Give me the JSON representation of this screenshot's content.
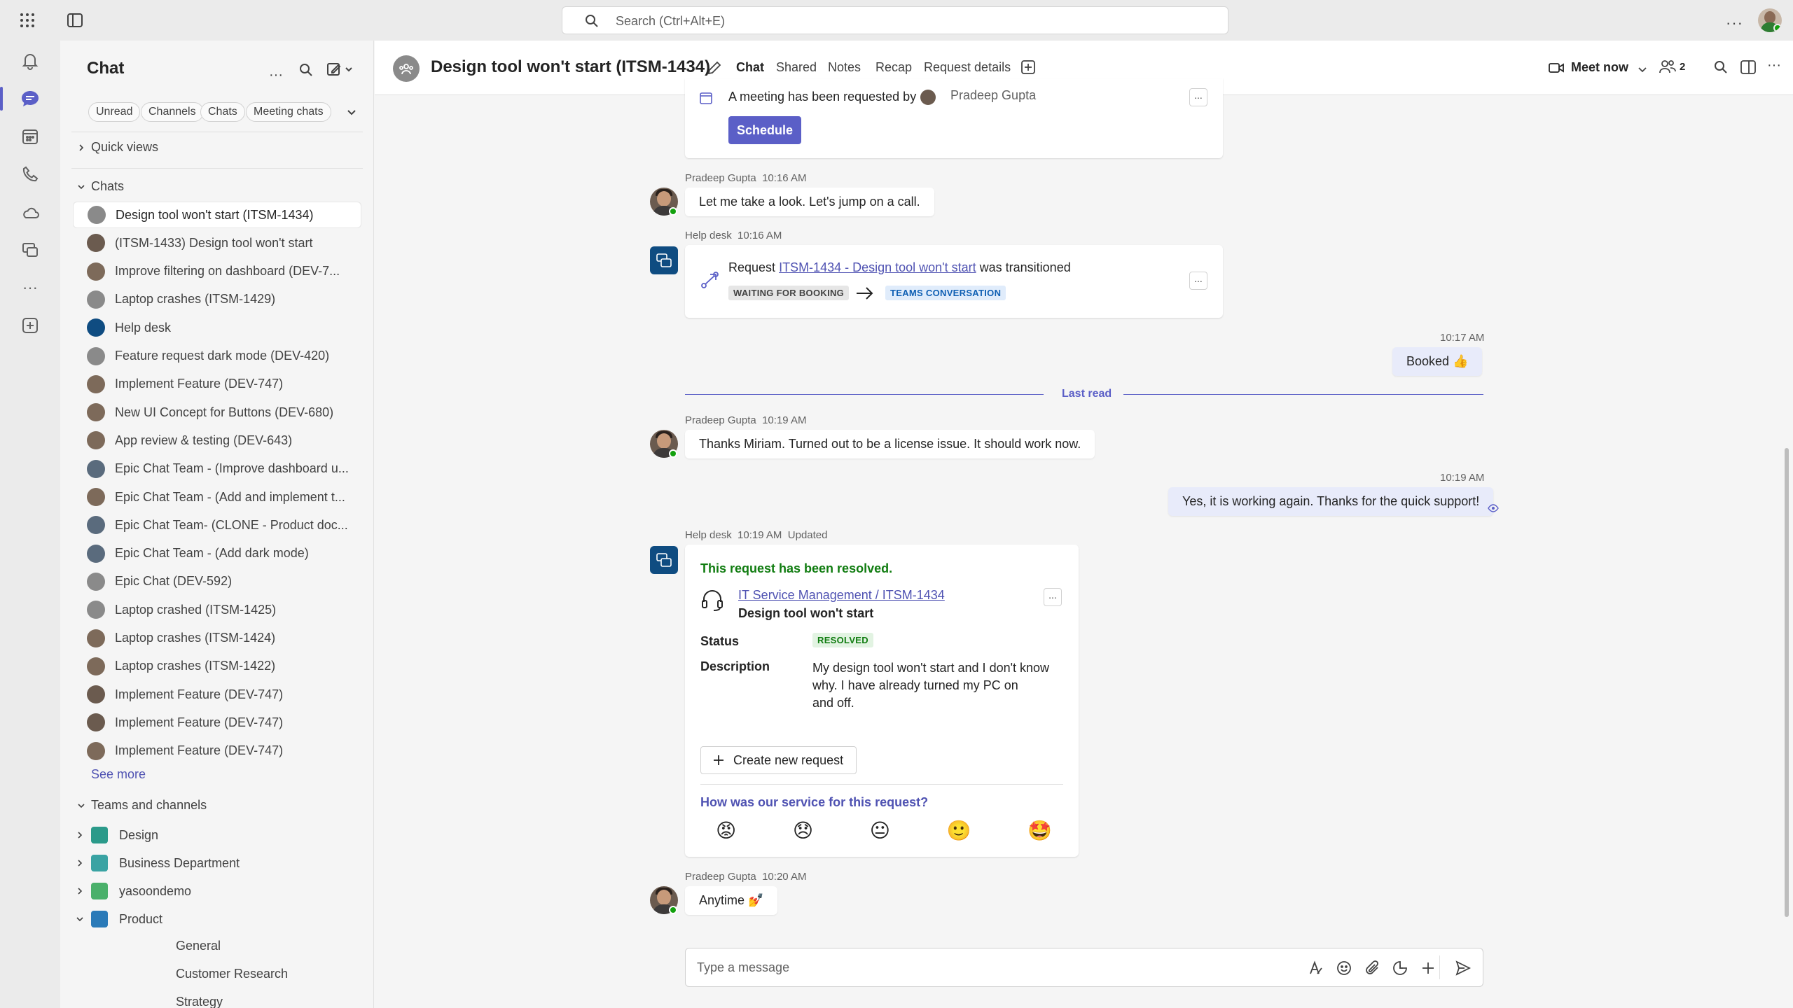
{
  "search": {
    "placeholder": "Search (Ctrl+Alt+E)"
  },
  "sidebar": {
    "title": "Chat",
    "filters": [
      "Unread",
      "Channels",
      "Chats",
      "Meeting chats"
    ],
    "quick_views": "Quick views",
    "chats_heading": "Chats",
    "chats": [
      "Design tool won't start (ITSM-1434)",
      "(ITSM-1433) Design tool won't start",
      "Improve filtering on dashboard (DEV-7...",
      "Laptop crashes (ITSM-1429)",
      "Help desk",
      "Feature request dark mode (DEV-420)",
      "Implement Feature (DEV-747)",
      "New UI Concept for Buttons (DEV-680)",
      "App review & testing (DEV-643)",
      "Epic Chat Team - (Improve dashboard u...",
      "Epic Chat Team - (Add and implement t...",
      "Epic Chat Team- (CLONE - Product doc...",
      "Epic Chat Team - (Add dark mode)",
      "Epic Chat (DEV-592)",
      "Laptop crashed (ITSM-1425)",
      "Laptop crashes (ITSM-1424)",
      "Laptop crashes (ITSM-1422)",
      "Implement Feature (DEV-747)",
      "Implement Feature (DEV-747)",
      "Implement Feature (DEV-747)"
    ],
    "see_more": "See more",
    "teams_heading": "Teams and channels",
    "teams": [
      "Design",
      "Business Department",
      "yasoondemo",
      "Product"
    ],
    "channels": [
      "General",
      "Customer Research",
      "Strategy"
    ]
  },
  "header": {
    "title": "Design tool won't start (ITSM-1434)",
    "tabs": [
      "Chat",
      "Shared",
      "Notes",
      "Recap",
      "Request details"
    ],
    "meet_now": "Meet now",
    "participants": "2"
  },
  "messages": {
    "meeting_request": "A meeting has been requested by",
    "meeting_requester": "Pradeep Gupta",
    "schedule_btn": "Schedule",
    "m1_sender": "Pradeep Gupta",
    "m1_time": "10:16 AM",
    "m1_text": "Let me take a look. Let's jump on a call.",
    "m2_sender": "Help desk",
    "m2_time": "10:16 AM",
    "m2_prefix": "Request",
    "m2_link": "ITSM-1434 - Design tool won't start",
    "m2_suffix": "was transitioned",
    "m2_from": "WAITING FOR BOOKING",
    "m2_to": "TEAMS CONVERSATION",
    "m3_time": "10:17 AM",
    "m3_text": "Booked 👍",
    "last_read": "Last read",
    "m4_sender": "Pradeep Gupta",
    "m4_time": "10:19 AM",
    "m4_text": "Thanks Miriam. Turned out to be a license issue. It should work now.",
    "m5_time": "10:19 AM",
    "m5_text": "Yes, it is working again. Thanks for the quick support!",
    "m6_sender": "Help desk",
    "m6_time": "10:19 AM",
    "m6_updated": "Updated",
    "m6_resolved": "This request has been resolved.",
    "m6_link": "IT Service Management / ITSM-1434",
    "m6_subtitle": "Design tool won't start",
    "m6_status_label": "Status",
    "m6_status_value": "RESOLVED",
    "m6_desc_label": "Description",
    "m6_desc_l1": "My design tool won't start and I don't know",
    "m6_desc_l2": "why. I have already turned my PC on",
    "m6_desc_l3": "and off.",
    "m6_create_btn": "Create new request",
    "m6_rating_q": "How was our service for this request?",
    "m6_ratings": [
      "😡",
      "😞",
      "😐",
      "🙂",
      "🤩"
    ],
    "m7_sender": "Pradeep Gupta",
    "m7_time": "10:20 AM",
    "m7_text": "Anytime 💅"
  },
  "composer": {
    "placeholder": "Type a message"
  },
  "colors": {
    "brand": "#5b5fc7",
    "resolved": "#107c10",
    "link": "#4f52b2"
  }
}
